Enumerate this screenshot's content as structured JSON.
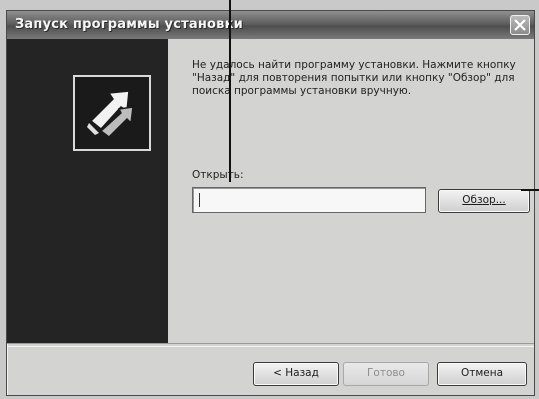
{
  "window": {
    "title": "Запуск программы установки"
  },
  "icons": {
    "close": "close-icon",
    "logo": "setup-arrows-icon"
  },
  "content": {
    "message": "Не удалось найти программу установки. Нажмите кнопку \"Назад\" для повторения попытки или кнопку \"Обзор\" для поиска программы установки вручную.",
    "open_label": "Открыть:",
    "open_value": "",
    "browse_label": "Обзор..."
  },
  "buttons": {
    "back": "< Назад",
    "finish": "Готово",
    "cancel": "Отмена"
  },
  "colors": {
    "side_panel": "#242424",
    "window_bg": "#d3d3d1",
    "titlebar": "#5f5f5f"
  }
}
